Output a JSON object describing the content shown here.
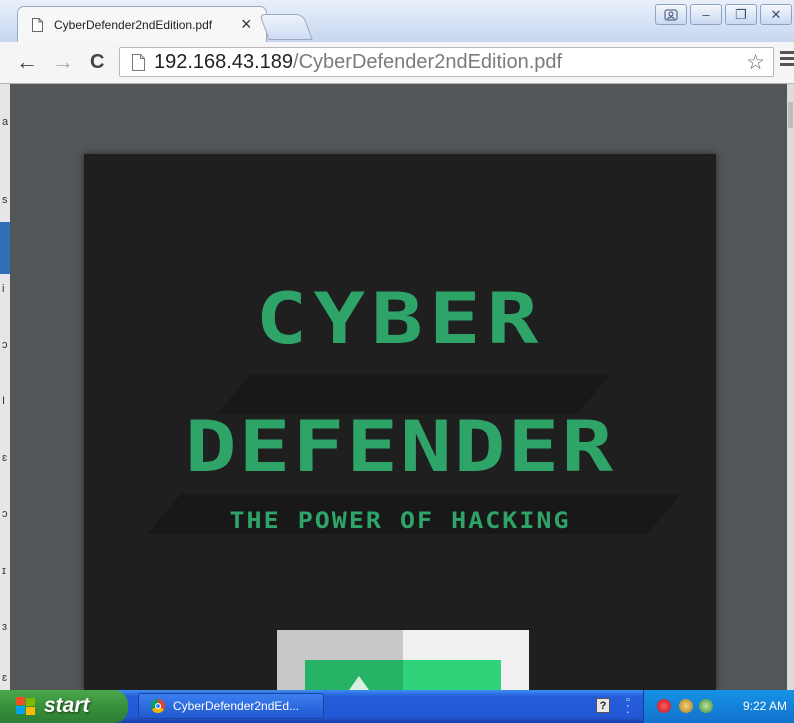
{
  "tab": {
    "title": "CyberDefender2ndEdition.pdf",
    "close": "×"
  },
  "window": {
    "user_icon": "user-icon",
    "min": "–",
    "max": "❐",
    "close": "✕"
  },
  "toolbar": {
    "back": "←",
    "forward": "→",
    "reload": "C",
    "star": "☆"
  },
  "address": {
    "host": "192.168.43.189",
    "path": "/CyberDefender2ndEdition.pdf"
  },
  "document": {
    "line1": "CYBER",
    "line2": "DEFENDER",
    "tagline": "THE POWER OF HACKING"
  },
  "left_strip": [
    "a",
    "s",
    "i",
    "ɔ",
    "I",
    "ɛ",
    "ɔ",
    "ɪ",
    "ɜ",
    "ɛ"
  ],
  "taskbar": {
    "start": "start",
    "task": "CyberDefender2ndEd...",
    "help": "?",
    "time": "9:22 AM"
  },
  "colors": {
    "title_green": "#2fa468",
    "page_bg": "#1f1f1f",
    "viewer_bg": "#525659",
    "taskbar_blue": "#245ddb",
    "start_green": "#37913c"
  }
}
